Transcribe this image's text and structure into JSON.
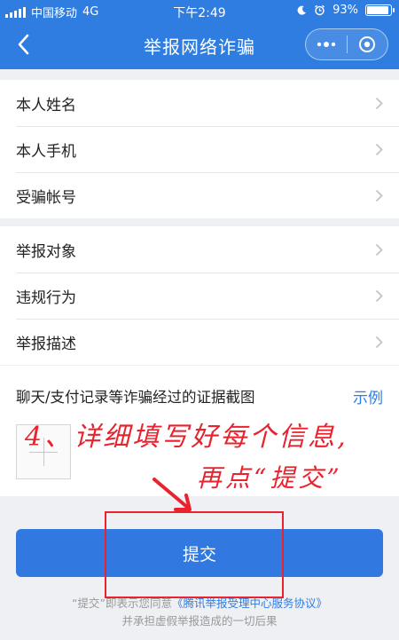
{
  "status": {
    "carrier": "中国移动",
    "network": "4G",
    "time": "下午2:49",
    "battery": "93%",
    "battery_level": 0.93
  },
  "nav": {
    "title": "举报网络诈骗",
    "back_icon": "chevron-left-icon",
    "more_icon": "more-dots-icon",
    "close_icon": "target-circle-icon"
  },
  "form": {
    "group1": [
      {
        "label": "本人姓名"
      },
      {
        "label": "本人手机"
      },
      {
        "label": "受骗帐号"
      }
    ],
    "group2": [
      {
        "label": "举报对象"
      },
      {
        "label": "违规行为"
      },
      {
        "label": "举报描述"
      }
    ],
    "evidence_label": "聊天/支付记录等诈骗经过的证据截图",
    "evidence_example": "示例"
  },
  "annotation": {
    "line1": "4、详细填写好每个信息,",
    "line2": "再点“提交”"
  },
  "submit_label": "提交",
  "footer": {
    "prefix": "“提交”即表示您同意",
    "agreement": "《腾讯举报受理中心服务协议》",
    "line2": "并承担虚假举报造成的一切后果"
  },
  "colors": {
    "primary": "#2f7de1",
    "annotation_red": "#e8232d"
  }
}
